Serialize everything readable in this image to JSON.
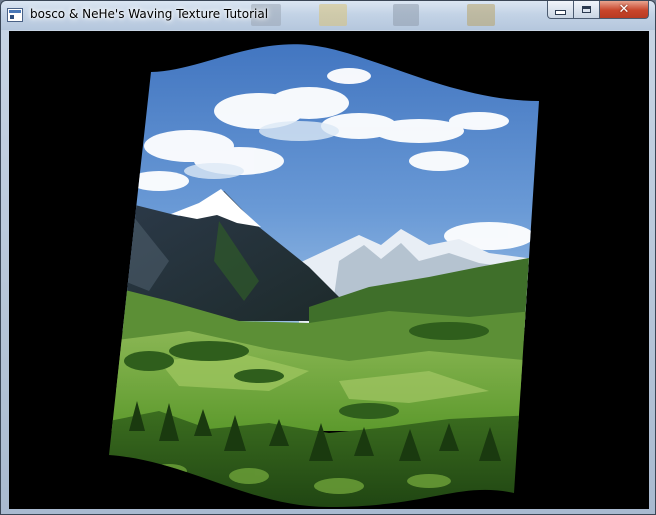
{
  "window": {
    "title": "bosco & NeHe's Waving Texture Tutorial",
    "client_background": "#000000",
    "titlebar_color": "#c3d3e6",
    "close_button_color": "#c8452b"
  },
  "icons": {
    "app": "application-window-icon",
    "minimize": "minimize-icon",
    "maximize": "maximize-icon",
    "close": "close-icon"
  },
  "scene": {
    "description_tag": "waving-texture-mountain-landscape",
    "sky_color": "#5f8fd0",
    "snow_color": "#ffffff",
    "forest_color": "#3e7a22",
    "meadow_color": "#7fb043"
  }
}
